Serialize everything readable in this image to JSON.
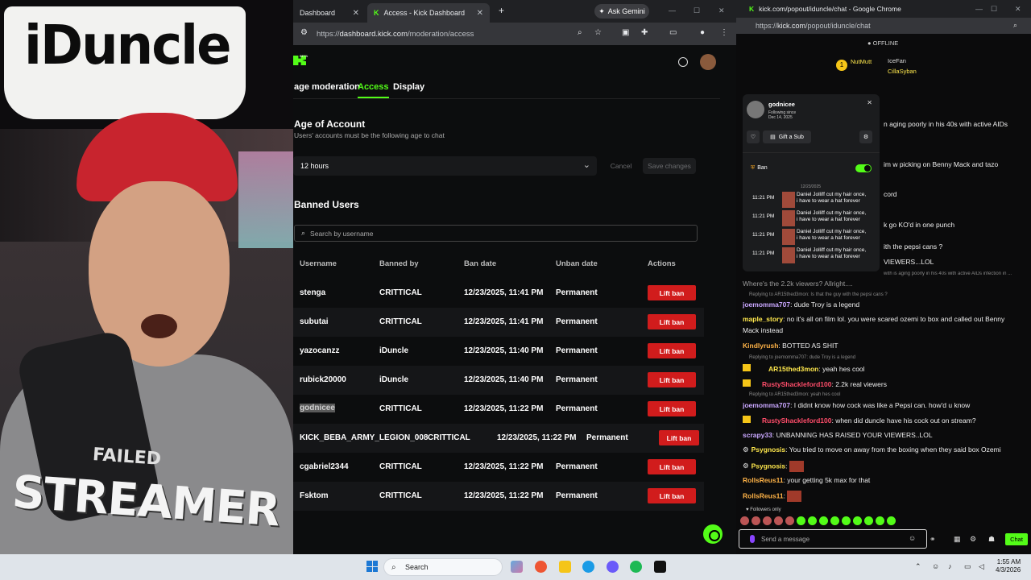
{
  "overlay": {
    "brand": "iDuncle",
    "shirt_line1": "FAILED",
    "shirt_line2": "STREAMER"
  },
  "left_browser": {
    "tabs": [
      {
        "label": "Dashboard"
      },
      {
        "label": "Access - Kick Dashboard"
      }
    ],
    "new_tab": "+",
    "ask_gemini": "Ask Gemini",
    "url_prefix": "https://",
    "url_host": "dashboard.kick.com",
    "url_path": "/moderation/access",
    "beta": "BETA",
    "subnav": [
      "age moderation",
      "Access",
      "Display"
    ],
    "age_section": {
      "title": "Age of Account",
      "subtitle": "Users' accounts must be the following age to chat",
      "selected": "12 hours",
      "cancel": "Cancel",
      "save": "Save changes"
    },
    "banned": {
      "title": "Banned Users",
      "search_placeholder": "Search by username",
      "columns": [
        "Username",
        "Banned by",
        "Ban date",
        "Unban date",
        "Actions"
      ],
      "rows": [
        {
          "user": "stenga",
          "by": "CRITTICAL",
          "date": "12/23/2025, 11:41 PM",
          "unban": "Permanent",
          "action": "Lift ban"
        },
        {
          "user": "subutai",
          "by": "CRITTICAL",
          "date": "12/23/2025, 11:41 PM",
          "unban": "Permanent",
          "action": "Lift ban"
        },
        {
          "user": "yazocanzz",
          "by": "iDuncle",
          "date": "12/23/2025, 11:40 PM",
          "unban": "Permanent",
          "action": "Lift ban"
        },
        {
          "user": "rubick20000",
          "by": "iDuncle",
          "date": "12/23/2025, 11:40 PM",
          "unban": "Permanent",
          "action": "Lift ban"
        },
        {
          "user": "godnicee",
          "by": "CRITTICAL",
          "date": "12/23/2025, 11:22 PM",
          "unban": "Permanent",
          "action": "Lift ban"
        },
        {
          "user": "KICK_BEBA_ARMY_LEGION_008",
          "by": "CRITTICAL",
          "date": "12/23/2025, 11:22 PM",
          "unban": "Permanent",
          "action": "Lift ban"
        },
        {
          "user": "cgabriel2344",
          "by": "CRITTICAL",
          "date": "12/23/2025, 11:22 PM",
          "unban": "Permanent",
          "action": "Lift ban"
        },
        {
          "user": "Fsktom",
          "by": "CRITTICAL",
          "date": "12/23/2025, 11:22 PM",
          "unban": "Permanent",
          "action": "Lift ban"
        }
      ]
    }
  },
  "right_browser": {
    "title": "kick.com/popout/iduncle/chat - Google Chrome",
    "url_prefix": "https://",
    "url_host": "kick.com",
    "url_path": "/popout/iduncle/chat",
    "status": "OFFLINE",
    "top_gifters": [
      "NutMutt",
      "IceFan",
      "CillaSyban"
    ],
    "user_card": {
      "name": "godnicee",
      "following_label": "Following since",
      "following_date": "Dec 14, 2025",
      "gift": "Gift a Sub",
      "ban_label": "Ban",
      "log_date": "12/23/2025",
      "log_time": "11:21 PM",
      "log_message": "Daniel Jolliff cut my hair once, i have to wear a hat forever"
    },
    "partial_lines": [
      "n aging poorly in his 40s with active AIDs",
      "im w picking on Benny Mack and tazo",
      "cord",
      "k go KO'd in one punch",
      "ith the pepsi cans ?",
      "VIEWERS...LOL",
      "with is aging poorly in his 40s with active AIDs infection in ...",
      "Where's the 2.2k viewers? Allright...."
    ],
    "messages": [
      {
        "reply": "Replying to AR15thed3mon: Is that the guy with the pepsi cans ?",
        "user": "joemomma707",
        "color": "#c9a7ff",
        "text": "dude Troy is a legend"
      },
      {
        "reply": "",
        "user": "maple_story",
        "color": "#ffe84d",
        "text": "no it's all on film lol. you were scared ozemi to box and called out Benny"
      },
      {
        "reply": "",
        "user": "",
        "color": "#ffe84d",
        "text": "Mack instead"
      },
      {
        "reply": "",
        "user": "Kindlyrush",
        "color": "#ffb347",
        "text": "BOTTED AS SHIT"
      },
      {
        "reply": "Replying to joemomma707: dude Troy is a legend",
        "user": "AR15thed3mon",
        "color": "#ffe84d",
        "text": "yeah hes cool"
      },
      {
        "reply": "",
        "user": "RustyShackleford100",
        "color": "#ff4d6a",
        "text": "2.2k real viewers"
      },
      {
        "reply": "Replying to AR15thed3mon: yeah hes cool",
        "user": "joemomma707",
        "color": "#c9a7ff",
        "text": "I didnt know how cock was like a Pepsi can. how'd u know"
      },
      {
        "reply": "",
        "user": "RustyShackleford100",
        "color": "#ff4d6a",
        "text": "when did duncle have his cock out on stream?"
      },
      {
        "reply": "",
        "user": "scrapy33",
        "color": "#c9a7ff",
        "text": "UNBANNING HAS RAISED YOUR VIEWERS..LOL"
      },
      {
        "reply": "",
        "user": "Psygnosis",
        "color": "#ffe84d",
        "text": "You tried to move on away from the boxing when they said box Ozemi"
      },
      {
        "reply": "",
        "user": "Psygnosis",
        "color": "#ffe84d",
        "text": ""
      },
      {
        "reply": "",
        "user": "RollsReus11",
        "color": "#ffb347",
        "text": "your getting 5k max for that"
      },
      {
        "reply": "",
        "user": "RollsReus11",
        "color": "#ffb347",
        "text": ""
      }
    ],
    "followers_only": "Followers only",
    "send_placeholder": "Send a message",
    "chat_button": "Chat"
  },
  "taskbar": {
    "search": "Search",
    "time": "1:55 AM",
    "date": "4/3/2026"
  }
}
